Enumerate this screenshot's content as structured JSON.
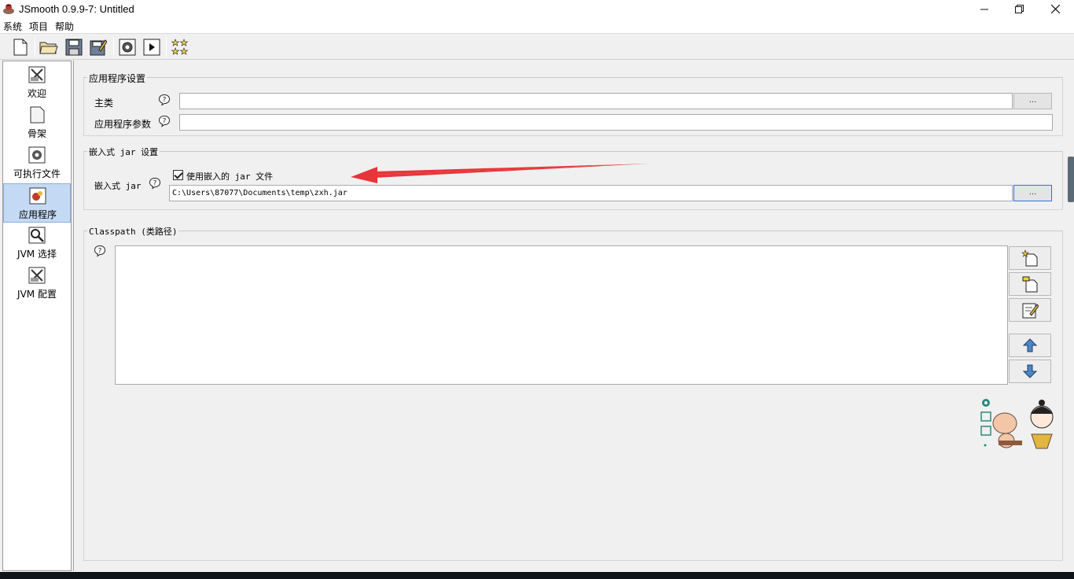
{
  "window": {
    "title": "JSmooth 0.9.9-7: Untitled",
    "controls": [
      "minimize",
      "maximize",
      "close"
    ]
  },
  "menu": {
    "items": [
      "系统",
      "项目",
      "帮助"
    ]
  },
  "toolbar": {
    "buttons": [
      "new-file-icon",
      "open-folder-icon",
      "save-icon",
      "save-as-icon",
      "compile-gear-icon",
      "run-icon",
      "about-stars-icon"
    ]
  },
  "sidebar": {
    "items": [
      {
        "label": "欢迎",
        "icon": "welcome-icon"
      },
      {
        "label": "骨架",
        "icon": "skeleton-icon"
      },
      {
        "label": "可执行文件",
        "icon": "executable-icon"
      },
      {
        "label": "应用程序",
        "icon": "application-icon",
        "selected": true
      },
      {
        "label": "JVM 选择",
        "icon": "jvm-select-icon"
      },
      {
        "label": "JVM 配置",
        "icon": "jvm-config-icon"
      }
    ]
  },
  "app_settings": {
    "legend": "应用程序设置",
    "main_class_label": "主类",
    "main_class_value": "",
    "browse_label": "...",
    "args_label": "应用程序参数",
    "args_value": ""
  },
  "embedded_jar": {
    "legend": "嵌入式 jar 设置",
    "label": "嵌入式 jar",
    "checkbox_label": "使用嵌入的 jar 文件",
    "checkbox_checked": true,
    "path_value": "C:\\Users\\87077\\Documents\\temp\\zxh.jar",
    "browse_label": "..."
  },
  "classpath": {
    "legend": "Classpath (类路径)",
    "entries": [],
    "buttons": [
      "add-classpath-icon",
      "add-directory-icon",
      "edit-entry-icon",
      "move-up-icon",
      "move-down-icon"
    ]
  },
  "colors": {
    "selected_bg": "#c4d9f4",
    "annotation_arrow": "#e8353a"
  }
}
